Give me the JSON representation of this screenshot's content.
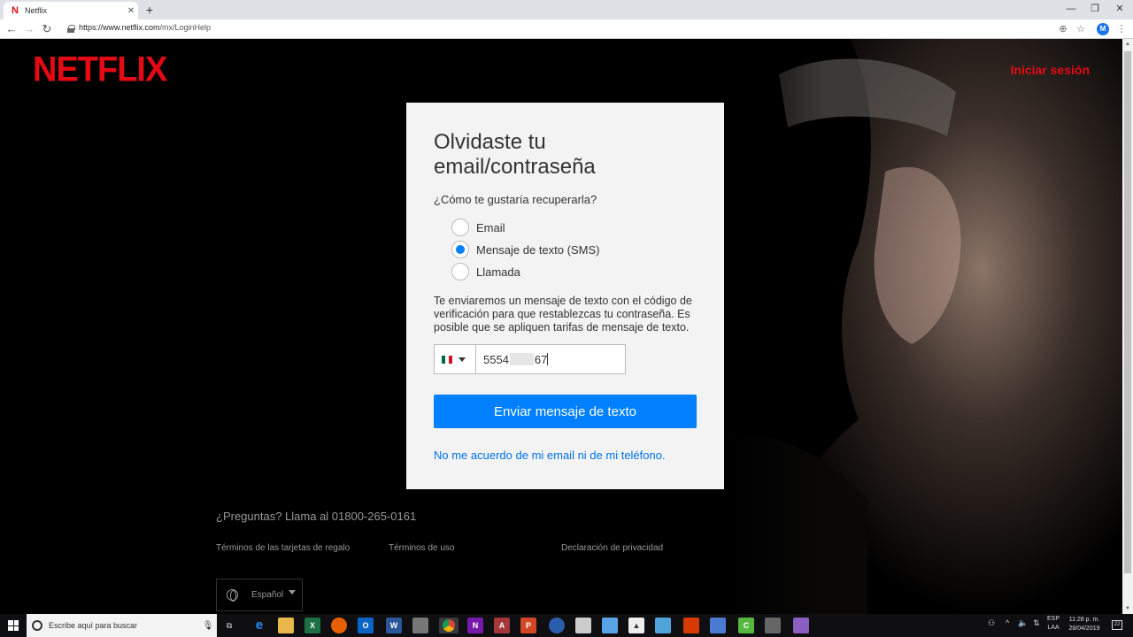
{
  "browser": {
    "tab_title": "Netflix",
    "tab_favicon": "N",
    "url_prefix": "https://www.netflix.com",
    "url_path": "/mx/LoginHelp",
    "profile_initial": "M"
  },
  "header": {
    "logo": "NETFLIX",
    "signin": "Iniciar sesión"
  },
  "card": {
    "title": "Olvidaste tu email/contraseña",
    "question": "¿Cómo te gustaría recuperarla?",
    "options": [
      {
        "label": "Email",
        "checked": false
      },
      {
        "label": "Mensaje de texto (SMS)",
        "checked": true
      },
      {
        "label": "Llamada",
        "checked": false
      }
    ],
    "info": "Te enviaremos un mensaje de texto con el código de verificación para que restablezcas tu contraseña. Es posible que se apliquen tarifas de mensaje de texto.",
    "phone_start": "5554",
    "phone_end": "67",
    "send_button": "Enviar mensaje de texto",
    "forgot_link": "No me acuerdo de mi email ni de mi teléfono."
  },
  "footer": {
    "questions": "¿Preguntas? Llama al 01800-265-0161",
    "links": [
      "Términos de las tarjetas de regalo",
      "Términos de uso",
      "Declaración de privacidad"
    ],
    "language": "Español"
  },
  "taskbar": {
    "search_placeholder": "Escribe aquí para buscar",
    "lang_top": "ESP",
    "lang_bottom": "LAA",
    "time": "11:28 p. m.",
    "date": "28/04/2019",
    "notifications": "22"
  },
  "colors": {
    "brand": "#e50914",
    "button": "#0080ff",
    "link": "#0071eb"
  }
}
